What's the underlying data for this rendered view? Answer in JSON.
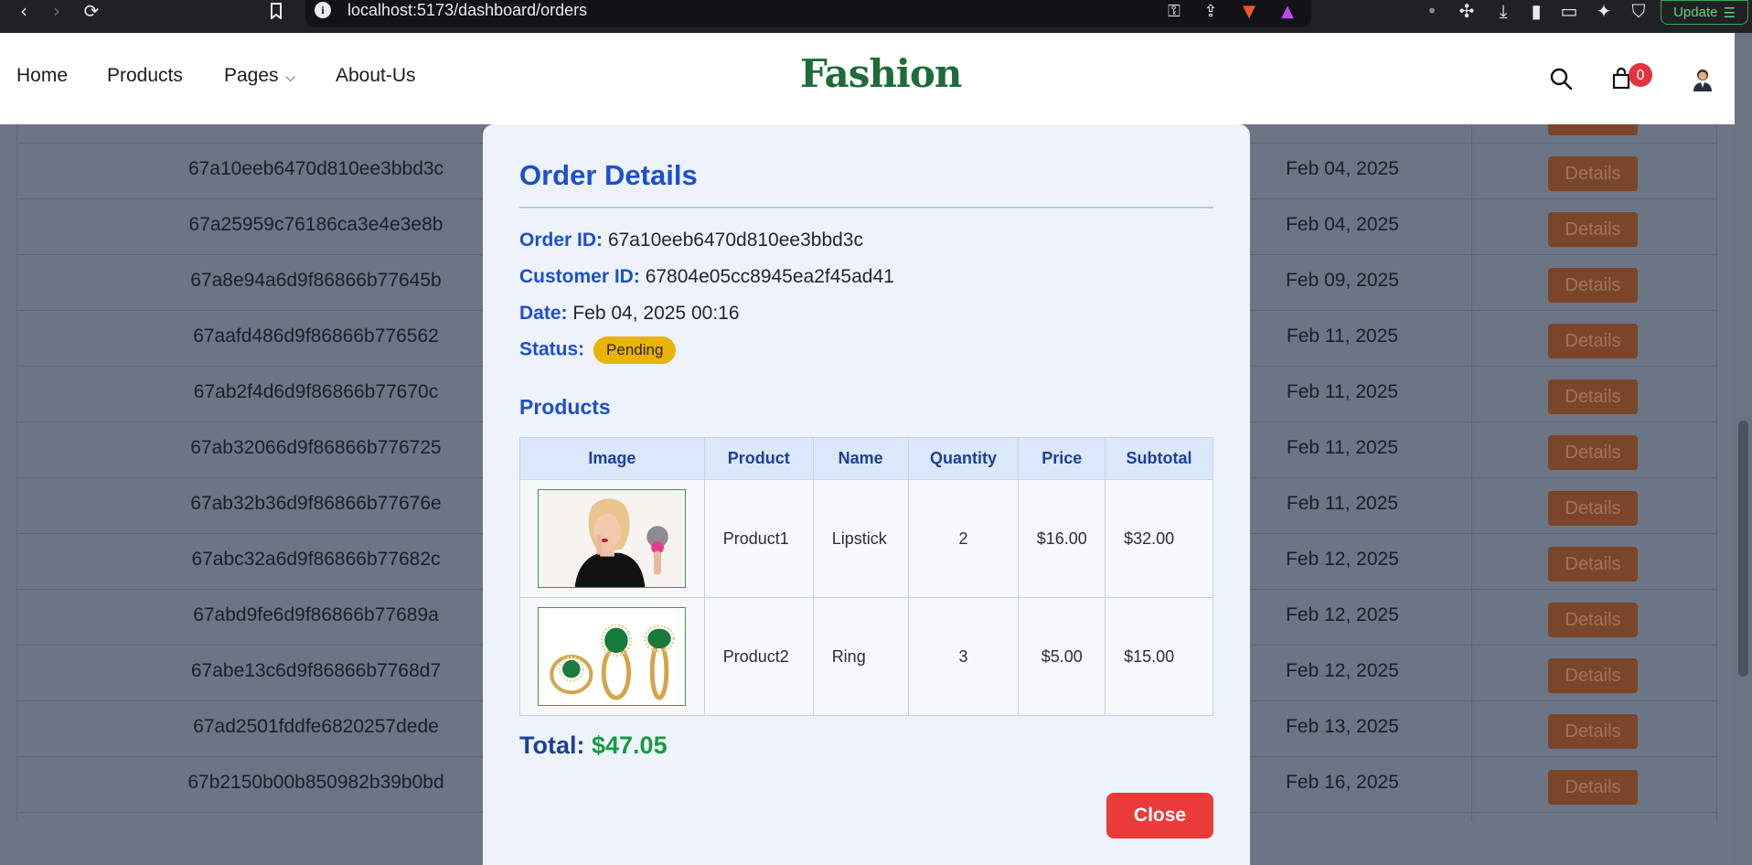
{
  "browser": {
    "url": "localhost:5173/dashboard/orders",
    "update_label": "Update"
  },
  "nav": {
    "links": [
      "Home",
      "Products",
      "Pages",
      "About-Us"
    ],
    "brand": "Fashion",
    "cart_count": "0"
  },
  "background_orders": [
    {
      "id": "67a10eeb6470d810ee3bbd3c",
      "date": "Feb 04, 2025",
      "action": "Details"
    },
    {
      "id": "67a25959c76186ca3e4e3e8b",
      "date": "Feb 04, 2025",
      "action": "Details"
    },
    {
      "id": "67a8e94a6d9f86866b77645b",
      "date": "Feb 09, 2025",
      "action": "Details"
    },
    {
      "id": "67aafd486d9f86866b776562",
      "date": "Feb 11, 2025",
      "action": "Details"
    },
    {
      "id": "67ab2f4d6d9f86866b77670c",
      "date": "Feb 11, 2025",
      "action": "Details"
    },
    {
      "id": "67ab32066d9f86866b776725",
      "date": "Feb 11, 2025",
      "action": "Details"
    },
    {
      "id": "67ab32b36d9f86866b77676e",
      "date": "Feb 11, 2025",
      "action": "Details"
    },
    {
      "id": "67abc32a6d9f86866b77682c",
      "date": "Feb 12, 2025",
      "action": "Details"
    },
    {
      "id": "67abd9fe6d9f86866b77689a",
      "date": "Feb 12, 2025",
      "action": "Details"
    },
    {
      "id": "67abe13c6d9f86866b7768d7",
      "date": "Feb 12, 2025",
      "action": "Details"
    },
    {
      "id": "67ad2501fddfe6820257dede",
      "date": "Feb 13, 2025",
      "action": "Details"
    },
    {
      "id": "67b2150b00b850982b39b0bd",
      "date": "Feb 16, 2025",
      "action": "Details"
    }
  ],
  "modal": {
    "title": "Order Details",
    "order_id_label": "Order ID:",
    "order_id": "67a10eeb6470d810ee3bbd3c",
    "customer_id_label": "Customer ID:",
    "customer_id": "67804e05cc8945ea2f45ad41",
    "date_label": "Date:",
    "date": "Feb 04, 2025 00:16",
    "status_label": "Status:",
    "status": "Pending",
    "products_heading": "Products",
    "columns": [
      "Image",
      "Product",
      "Name",
      "Quantity",
      "Price",
      "Subtotal"
    ],
    "rows": [
      {
        "image": "lipstick-photo",
        "product": "Product1",
        "name": "Lipstick",
        "quantity": "2",
        "price": "$16.00",
        "subtotal": "$32.00"
      },
      {
        "image": "ring-photo",
        "product": "Product2",
        "name": "Ring",
        "quantity": "3",
        "price": "$5.00",
        "subtotal": "$15.00"
      }
    ],
    "total_label": "Total:",
    "total_value": "$47.05",
    "close_label": "Close"
  },
  "colors": {
    "brand": "#1f6b3a",
    "accent_blue": "#1d4fcf",
    "status_pending": "#e9b308",
    "close_red": "#ea3b3b",
    "total_green": "#179b45"
  }
}
